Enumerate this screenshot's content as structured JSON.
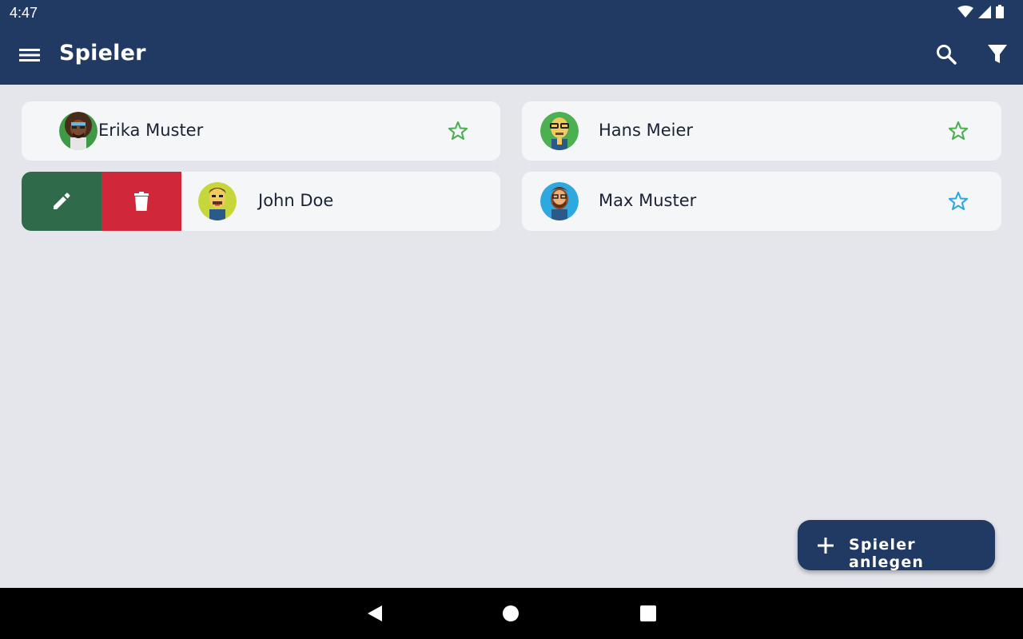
{
  "status_bar": {
    "time": "4:47"
  },
  "app_bar": {
    "title": "Spieler"
  },
  "players": [
    {
      "name": "Erika Muster",
      "favorite_color": "#4caf50"
    },
    {
      "name": "Hans Meier",
      "favorite_color": "#4caf50"
    },
    {
      "name": "John Doe"
    },
    {
      "name": "Max Muster",
      "favorite_color": "#2ea9e0"
    }
  ],
  "swipe_actions": {
    "edit_icon": "pencil-icon",
    "delete_icon": "trash-icon"
  },
  "fab": {
    "label": "Spieler anlegen"
  },
  "colors": {
    "primary": "#213a63",
    "edit": "#2f6a4b",
    "delete": "#d0283a",
    "background": "#e4e6eb"
  }
}
